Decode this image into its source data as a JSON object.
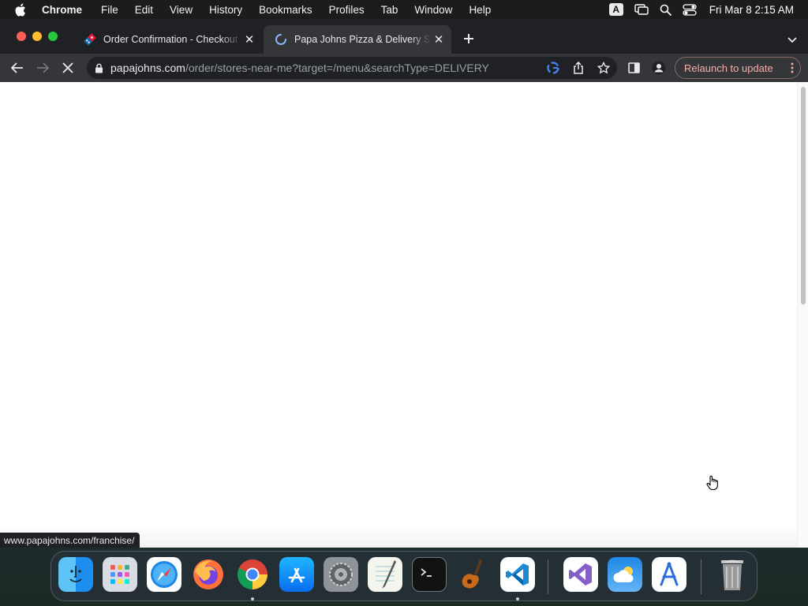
{
  "menubar": {
    "app": "Chrome",
    "items": [
      "File",
      "Edit",
      "View",
      "History",
      "Bookmarks",
      "Profiles",
      "Tab",
      "Window",
      "Help"
    ],
    "input_badge": "A",
    "clock": "Fri Mar 8  2:15 AM"
  },
  "tabs": [
    {
      "title": "Order Confirmation - Checkout",
      "favicon": "dominos-icon",
      "active": false
    },
    {
      "title": "Papa Johns Pizza & Delivery St",
      "favicon": "loading-spinner-icon",
      "active": true
    }
  ],
  "omnibox": {
    "host": "papajohns.com",
    "path": "/order/stores-near-me?target=/menu&searchType=DELIVERY"
  },
  "toolbar": {
    "relaunch_label": "Relaunch to update"
  },
  "status_bar": {
    "url": "www.papajohns.com/franchise/"
  },
  "colors": {
    "tabstrip": "#202124",
    "toolbar": "#35363a",
    "relaunch_text": "#f6aea9"
  },
  "dock": {
    "apps": [
      {
        "name": "Finder",
        "icon": "finder-icon"
      },
      {
        "name": "Launchpad",
        "icon": "launchpad-icon"
      },
      {
        "name": "Safari",
        "icon": "safari-icon"
      },
      {
        "name": "Firefox",
        "icon": "firefox-icon"
      },
      {
        "name": "Chrome",
        "icon": "chrome-icon"
      },
      {
        "name": "App Store",
        "icon": "app-store-icon"
      },
      {
        "name": "System Preferences",
        "icon": "system-preferences-icon"
      },
      {
        "name": "TextEdit",
        "icon": "textedit-icon"
      },
      {
        "name": "Terminal",
        "icon": "terminal-icon"
      },
      {
        "name": "GarageBand",
        "icon": "garageband-icon"
      },
      {
        "name": "Visual Studio Code",
        "icon": "vscode-icon"
      },
      {
        "name": "Visual Studio",
        "icon": "visual-studio-icon"
      },
      {
        "name": "Weather",
        "icon": "weather-icon"
      },
      {
        "name": "Xcode Instruments",
        "icon": "instruments-icon"
      },
      {
        "name": "Trash",
        "icon": "trash-icon"
      }
    ]
  }
}
